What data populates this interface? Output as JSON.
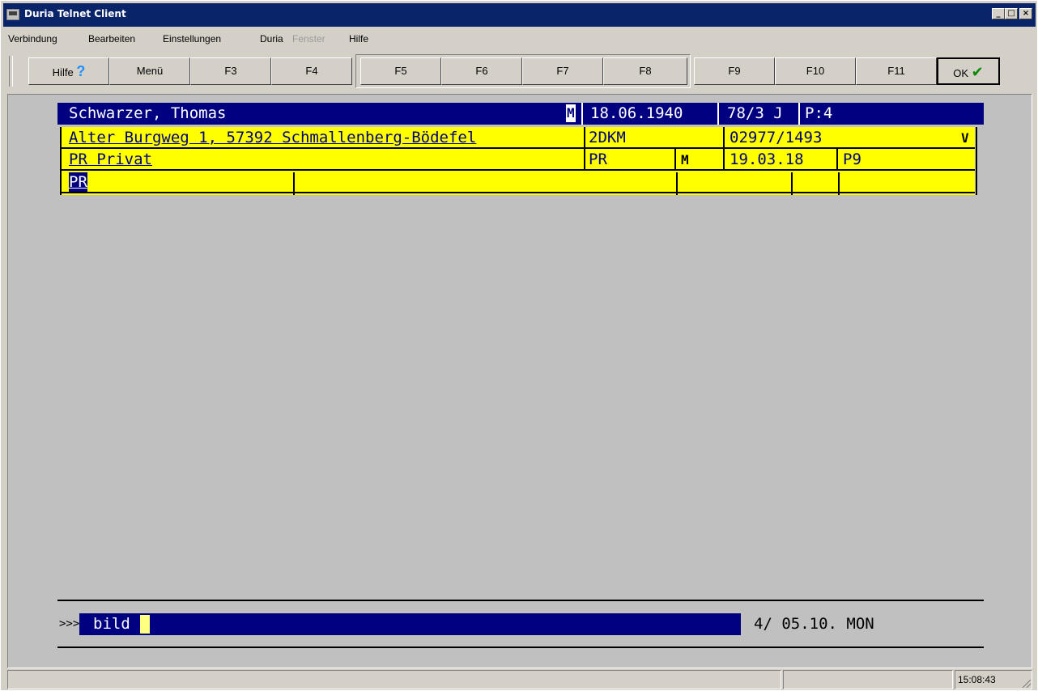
{
  "window": {
    "title": "Duria Telnet Client",
    "min_glyph": "_",
    "max_glyph": "□",
    "close_glyph": "×"
  },
  "menu": [
    "Verbindung",
    "Bearbeiten",
    "Einstellungen",
    "Duria",
    "Fenster",
    "Hilfe"
  ],
  "menu_disabled": [
    "Fenster"
  ],
  "toolbar": {
    "hilfe": "Hilfe",
    "menu": "Menü",
    "f3": "F3",
    "f4": "F4",
    "f5": "F5",
    "f6": "F6",
    "f7": "F7",
    "f8": "F8",
    "f9": "F9",
    "f10": "F10",
    "f11": "F11",
    "ok": "OK",
    "help_icon_glyph": "?",
    "ok_icon_glyph": "✔"
  },
  "patient": {
    "name": "Schwarzer, Thomas",
    "sex": "M",
    "birthdate": "18.06.1940",
    "age": "78/3 J",
    "p": "P:4",
    "address": "Alter Burgweg 1, 57392 Schmallenberg-Bödefel",
    "code": "2DKM",
    "phone": "02977/1493",
    "v": "V",
    "insurance": "PR Privat",
    "ins_code": "PR",
    "ins_flag": "M",
    "date": "19.03.18",
    "p9": "P9",
    "field": "PR"
  },
  "command": {
    "prompt": ">>>",
    "input": "bild",
    "info": "4/ 05.10. MON"
  },
  "status": {
    "time": "15:08:43"
  },
  "colors": {
    "title_bar": "#0a246a",
    "terminal_navy": "#000080",
    "terminal_yellow": "#ffff00",
    "terminal_bg": "#c0c0c0",
    "check_green": "#0a8a0a"
  }
}
